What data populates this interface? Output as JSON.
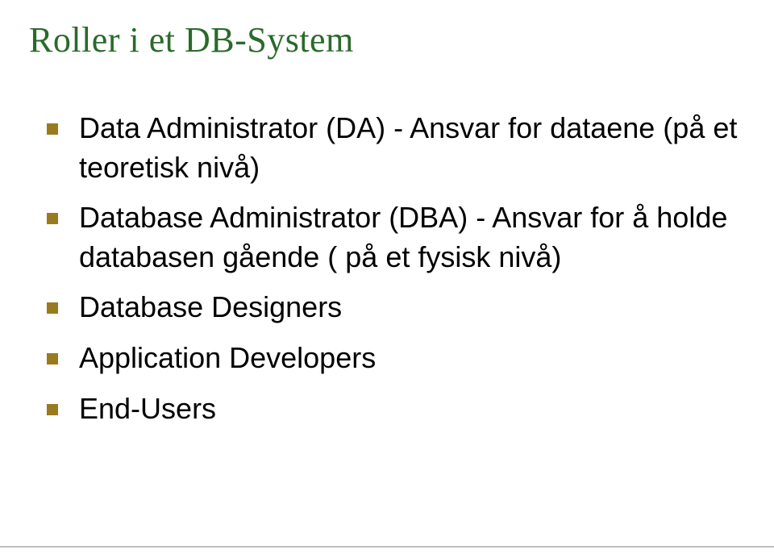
{
  "title": "Roller i et DB-System",
  "bullets": [
    "Data Administrator (DA) - Ansvar for dataene (på et teoretisk nivå)",
    "Database Administrator (DBA) - Ansvar for å holde databasen gående ( på et fysisk nivå)",
    "Database Designers",
    "Application Developers",
    "End-Users"
  ]
}
